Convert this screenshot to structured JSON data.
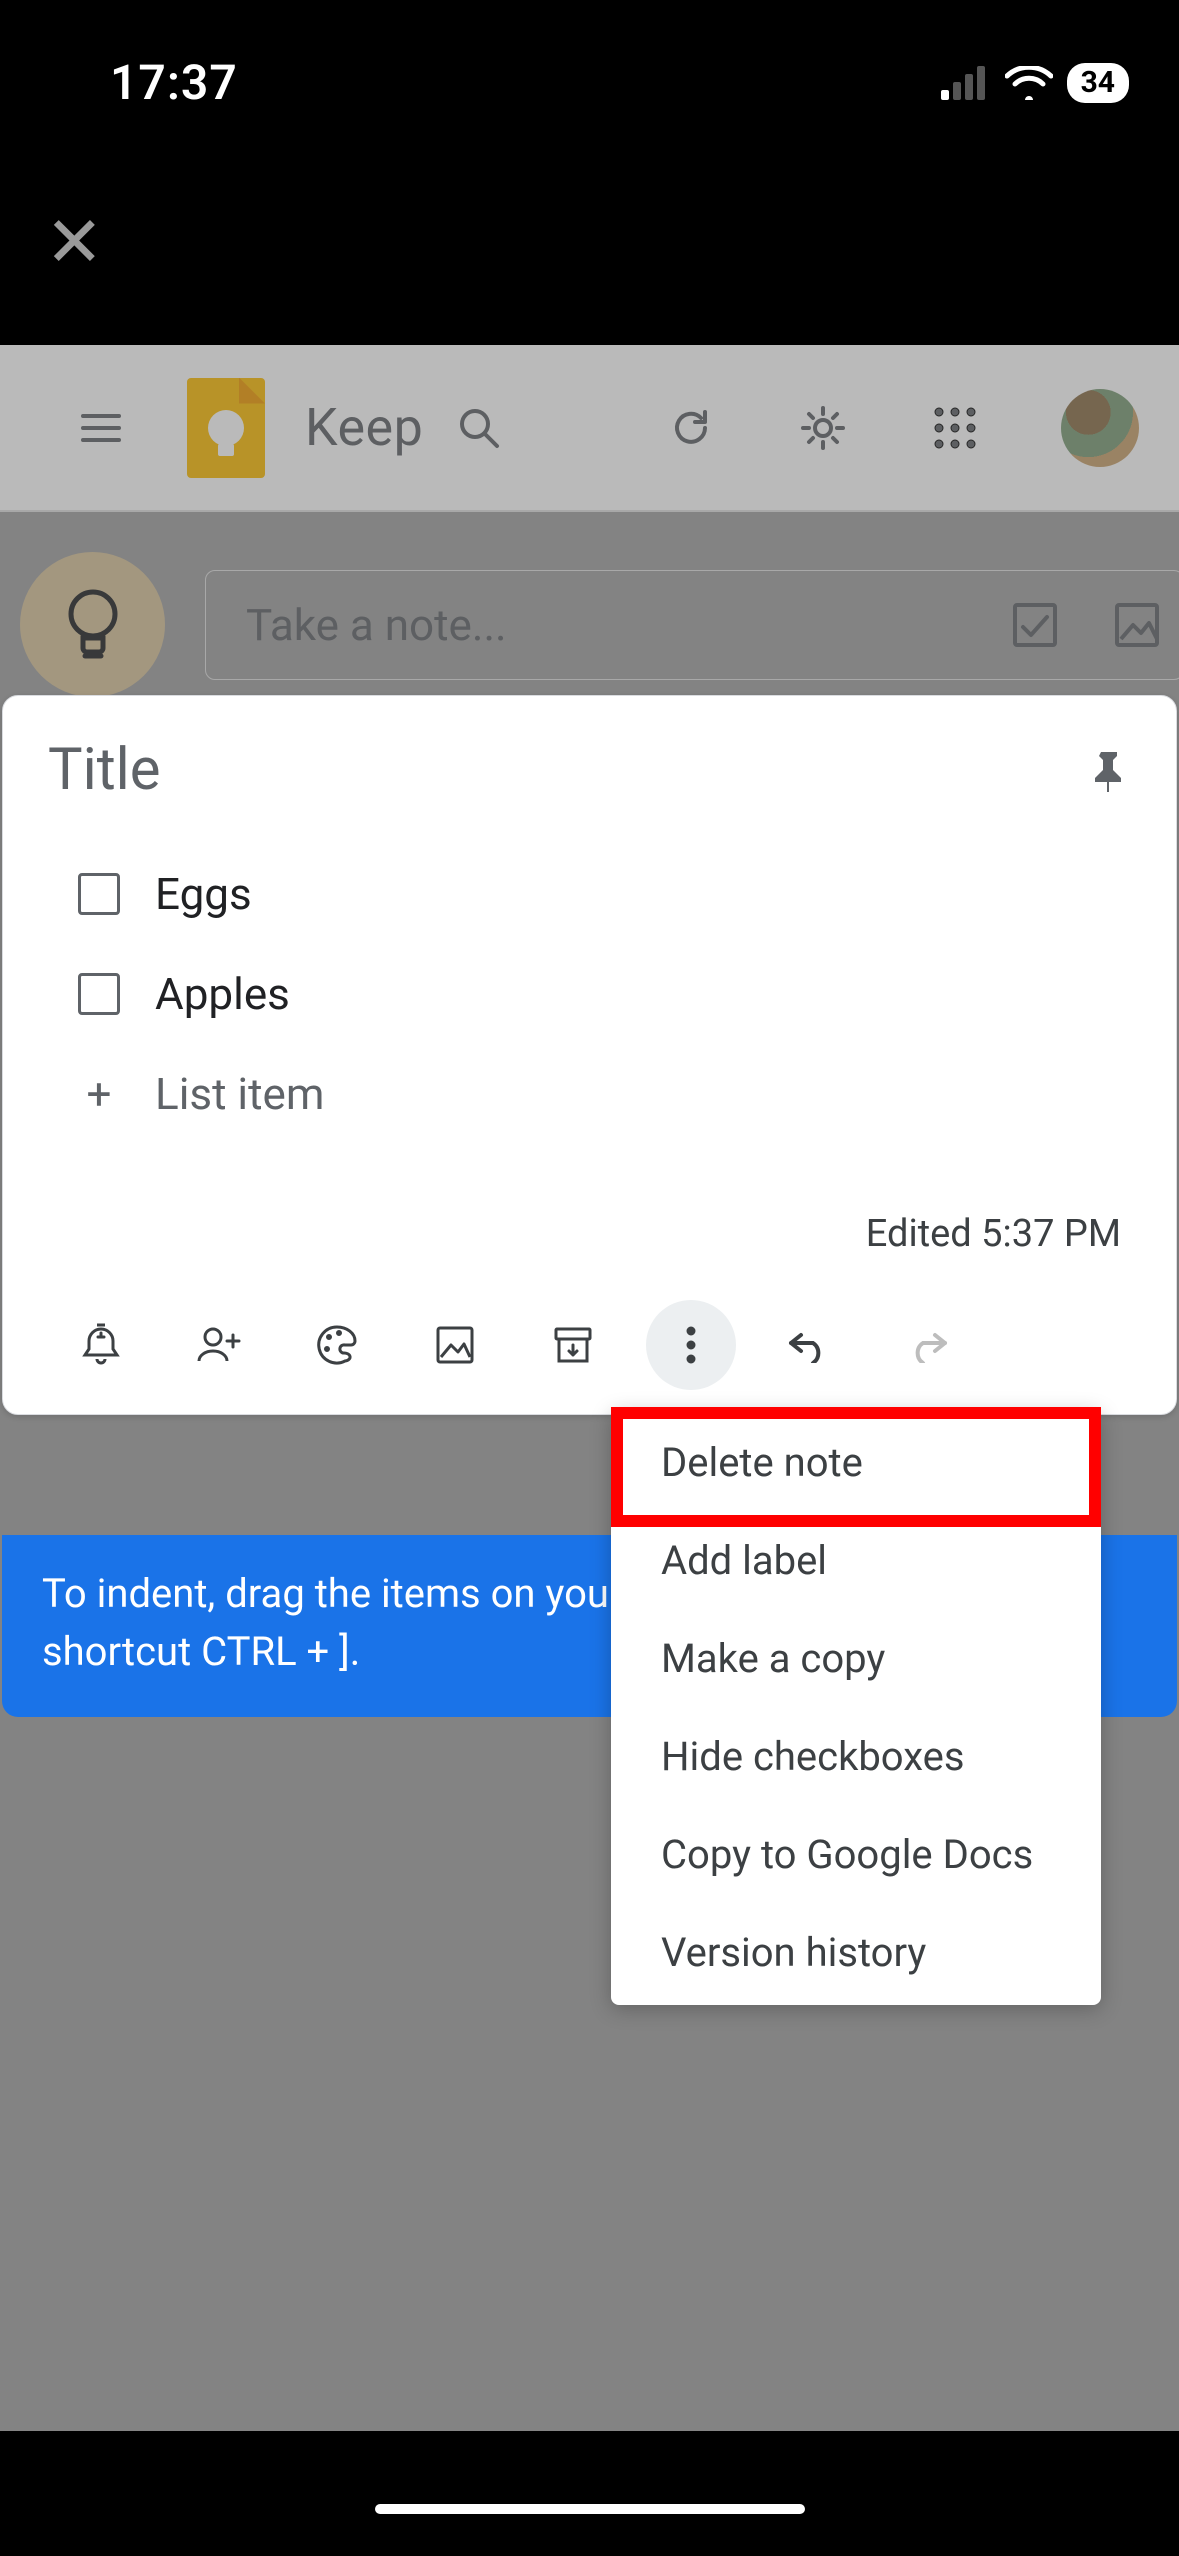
{
  "status": {
    "time": "17:37",
    "battery": "34"
  },
  "app": {
    "title": "Keep",
    "note_placeholder": "Take a note...",
    "avatar": "user-avatar"
  },
  "note": {
    "title_placeholder": "Title",
    "items": [
      "Eggs",
      "Apples"
    ],
    "add_item_label": "List item",
    "edited": "Edited 5:37 PM"
  },
  "toolbar_icons": [
    "reminder",
    "collaborator",
    "palette",
    "image",
    "archive",
    "more",
    "undo",
    "redo"
  ],
  "menu": {
    "items": [
      "Delete note",
      "Add label",
      "Make a copy",
      "Hide checkboxes",
      "Copy to Google Docs",
      "Version history"
    ],
    "highlighted_index": 0
  },
  "tip": {
    "line1": "To indent, drag the items on your",
    "line2": "shortcut CTRL + ]."
  }
}
